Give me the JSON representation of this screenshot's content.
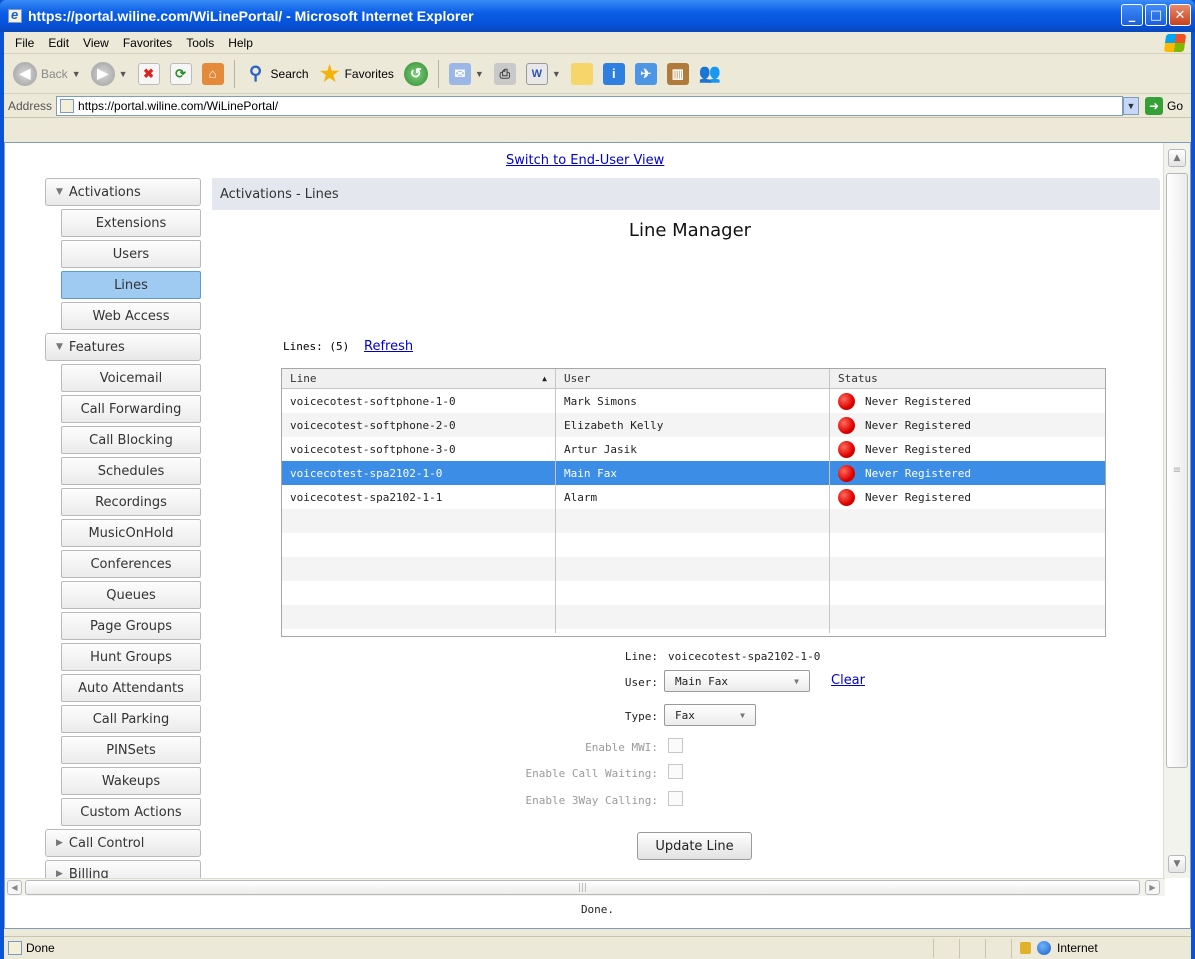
{
  "window": {
    "title": "https://portal.wiline.com/WiLinePortal/ - Microsoft Internet Explorer",
    "buttons": {
      "minimize": "_",
      "maximize": "□",
      "close": "✕"
    }
  },
  "menubar": {
    "items": [
      "File",
      "Edit",
      "View",
      "Favorites",
      "Tools",
      "Help"
    ]
  },
  "toolbar": {
    "back": "Back",
    "search": "Search",
    "favorites": "Favorites"
  },
  "address": {
    "label": "Address",
    "url": "https://portal.wiline.com/WiLinePortal/",
    "go": "Go"
  },
  "page": {
    "switch_link": "Switch to End-User View",
    "nav": {
      "groups": [
        {
          "label": "Activations",
          "expanded": true,
          "items": [
            "Extensions",
            "Users",
            "Lines",
            "Web Access"
          ],
          "active": "Lines"
        },
        {
          "label": "Features",
          "expanded": true,
          "items": [
            "Voicemail",
            "Call Forwarding",
            "Call Blocking",
            "Schedules",
            "Recordings",
            "MusicOnHold",
            "Conferences",
            "Queues",
            "Page Groups",
            "Hunt Groups",
            "Auto Attendants",
            "Call Parking",
            "PINSets",
            "Wakeups",
            "Custom Actions"
          ]
        },
        {
          "label": "Call Control",
          "expanded": false
        },
        {
          "label": "Billing",
          "expanded": false
        }
      ]
    },
    "header": "Activations - Lines",
    "title": "Line Manager",
    "lines_count": "Lines: (5)",
    "refresh": "Refresh",
    "table": {
      "columns": [
        "Line",
        "User",
        "Status"
      ],
      "sort_arrow": "▲",
      "rows": [
        {
          "line": "voicecotest-softphone-1-0",
          "user": "Mark Simons",
          "status": "Never Registered"
        },
        {
          "line": "voicecotest-softphone-2-0",
          "user": "Elizabeth Kelly",
          "status": "Never Registered"
        },
        {
          "line": "voicecotest-softphone-3-0",
          "user": "Artur Jasik",
          "status": "Never Registered"
        },
        {
          "line": "voicecotest-spa2102-1-0",
          "user": "Main Fax",
          "status": "Never Registered",
          "selected": true
        },
        {
          "line": "voicecotest-spa2102-1-1",
          "user": "Alarm",
          "status": "Never Registered"
        }
      ],
      "status_color": "#dd0000",
      "selected_color": "#3b8de6"
    },
    "form": {
      "line_label": "Line:",
      "line_value": "voicecotest-spa2102-1-0",
      "user_label": "User:",
      "user_value": "Main Fax",
      "clear": "Clear",
      "type_label": "Type:",
      "type_value": "Fax",
      "mwi_label": "Enable MWI:",
      "call_waiting_label": "Enable Call Waiting:",
      "threeway_label": "Enable 3Way Calling:",
      "update_button": "Update Line"
    },
    "page_status": "Done."
  },
  "statusbar": {
    "text": "Done",
    "zone": "Internet"
  }
}
